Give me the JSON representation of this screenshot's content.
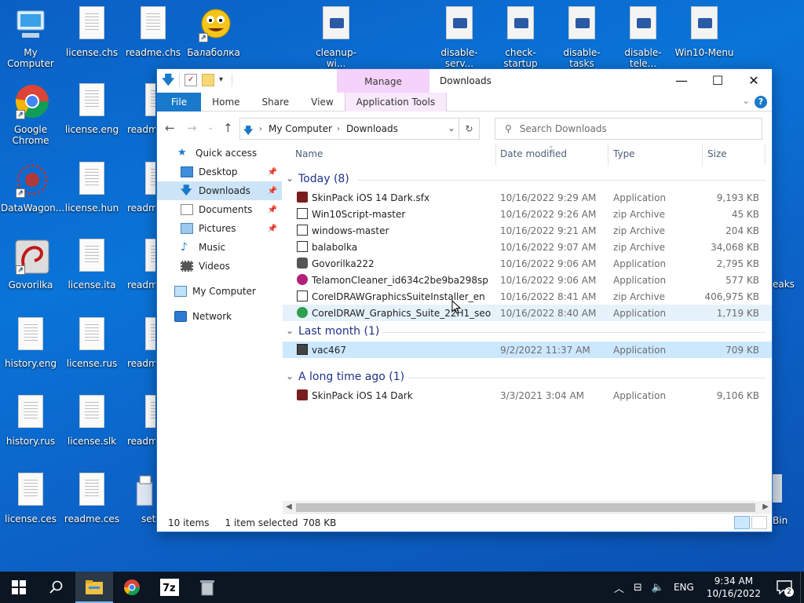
{
  "desktop": {
    "icons_col1": [
      "My Computer",
      "Google Chrome",
      "DataWagon...",
      "Govorilka",
      "history.eng",
      "history.rus",
      "license.ces"
    ],
    "icons_col2": [
      "license.chs",
      "license.eng",
      "license.hun",
      "license.ita",
      "license.rus",
      "license.slk",
      "readme.ces"
    ],
    "icons_col3": [
      "readme.chs",
      "readm",
      "readm",
      "readm",
      "readm",
      "readm",
      "setu"
    ],
    "icons_top": [
      "Балаболка",
      "cleanup-wi...",
      "disable-serv...",
      "check-startup",
      "disable-tasks",
      "disable-tele...",
      "Win10-Menu"
    ],
    "edge_labels": [
      "eaks",
      "Bin"
    ]
  },
  "window": {
    "title": "Downloads",
    "manage_tab": "Manage",
    "controls": {
      "minimize": "—",
      "maximize": "☐",
      "close": "✕"
    },
    "ribbon_tabs": [
      "File",
      "Home",
      "Share",
      "View",
      "Application Tools"
    ],
    "help": "?",
    "address": {
      "root": "My Computer",
      "current": "Downloads"
    },
    "search_placeholder": "Search Downloads"
  },
  "nav": {
    "quick_access": "Quick access",
    "items": [
      {
        "label": "Desktop",
        "pinned": true
      },
      {
        "label": "Downloads",
        "pinned": true
      },
      {
        "label": "Documents",
        "pinned": true
      },
      {
        "label": "Pictures",
        "pinned": true
      },
      {
        "label": "Music",
        "pinned": false
      },
      {
        "label": "Videos",
        "pinned": false
      }
    ],
    "my_computer": "My Computer",
    "network": "Network"
  },
  "columns": {
    "name": "Name",
    "date": "Date modified",
    "type": "Type",
    "size": "Size"
  },
  "groups": [
    {
      "title": "Today (8)",
      "files": [
        {
          "name": "SkinPack iOS 14 Dark.sfx",
          "date": "10/16/2022 9:29 AM",
          "type": "Application",
          "size": "9,193 KB"
        },
        {
          "name": "Win10Script-master",
          "date": "10/16/2022 9:26 AM",
          "type": "zip Archive",
          "size": "45 KB"
        },
        {
          "name": "windows-master",
          "date": "10/16/2022 9:21 AM",
          "type": "zip Archive",
          "size": "204 KB"
        },
        {
          "name": "balabolka",
          "date": "10/16/2022 9:07 AM",
          "type": "zip Archive",
          "size": "34,068 KB"
        },
        {
          "name": "Govorilka222",
          "date": "10/16/2022 9:06 AM",
          "type": "Application",
          "size": "2,795 KB"
        },
        {
          "name": "TelamonCleaner_id634c2be9ba298sp",
          "date": "10/16/2022 9:06 AM",
          "type": "Application",
          "size": "577 KB"
        },
        {
          "name": "CorelDRAWGraphicsSuiteInstaller_en",
          "date": "10/16/2022 8:41 AM",
          "type": "zip Archive",
          "size": "406,975 KB"
        },
        {
          "name": "CorelDRAW_Graphics_Suite_22H1_seo",
          "date": "10/16/2022 8:40 AM",
          "type": "Application",
          "size": "1,719 KB"
        }
      ]
    },
    {
      "title": "Last month (1)",
      "files": [
        {
          "name": "vac467",
          "date": "9/2/2022 11:37 AM",
          "type": "Application",
          "size": "709 KB"
        }
      ]
    },
    {
      "title": "A long time ago (1)",
      "files": [
        {
          "name": "SkinPack iOS 14 Dark",
          "date": "3/3/2021 3:04 AM",
          "type": "Application",
          "size": "9,106 KB"
        }
      ]
    }
  ],
  "status": {
    "items": "10 items",
    "selected": "1 item selected",
    "size": "708 KB"
  },
  "taskbar": {
    "lang": "ENG",
    "time": "9:34 AM",
    "date": "10/16/2022",
    "notifications": "2"
  }
}
